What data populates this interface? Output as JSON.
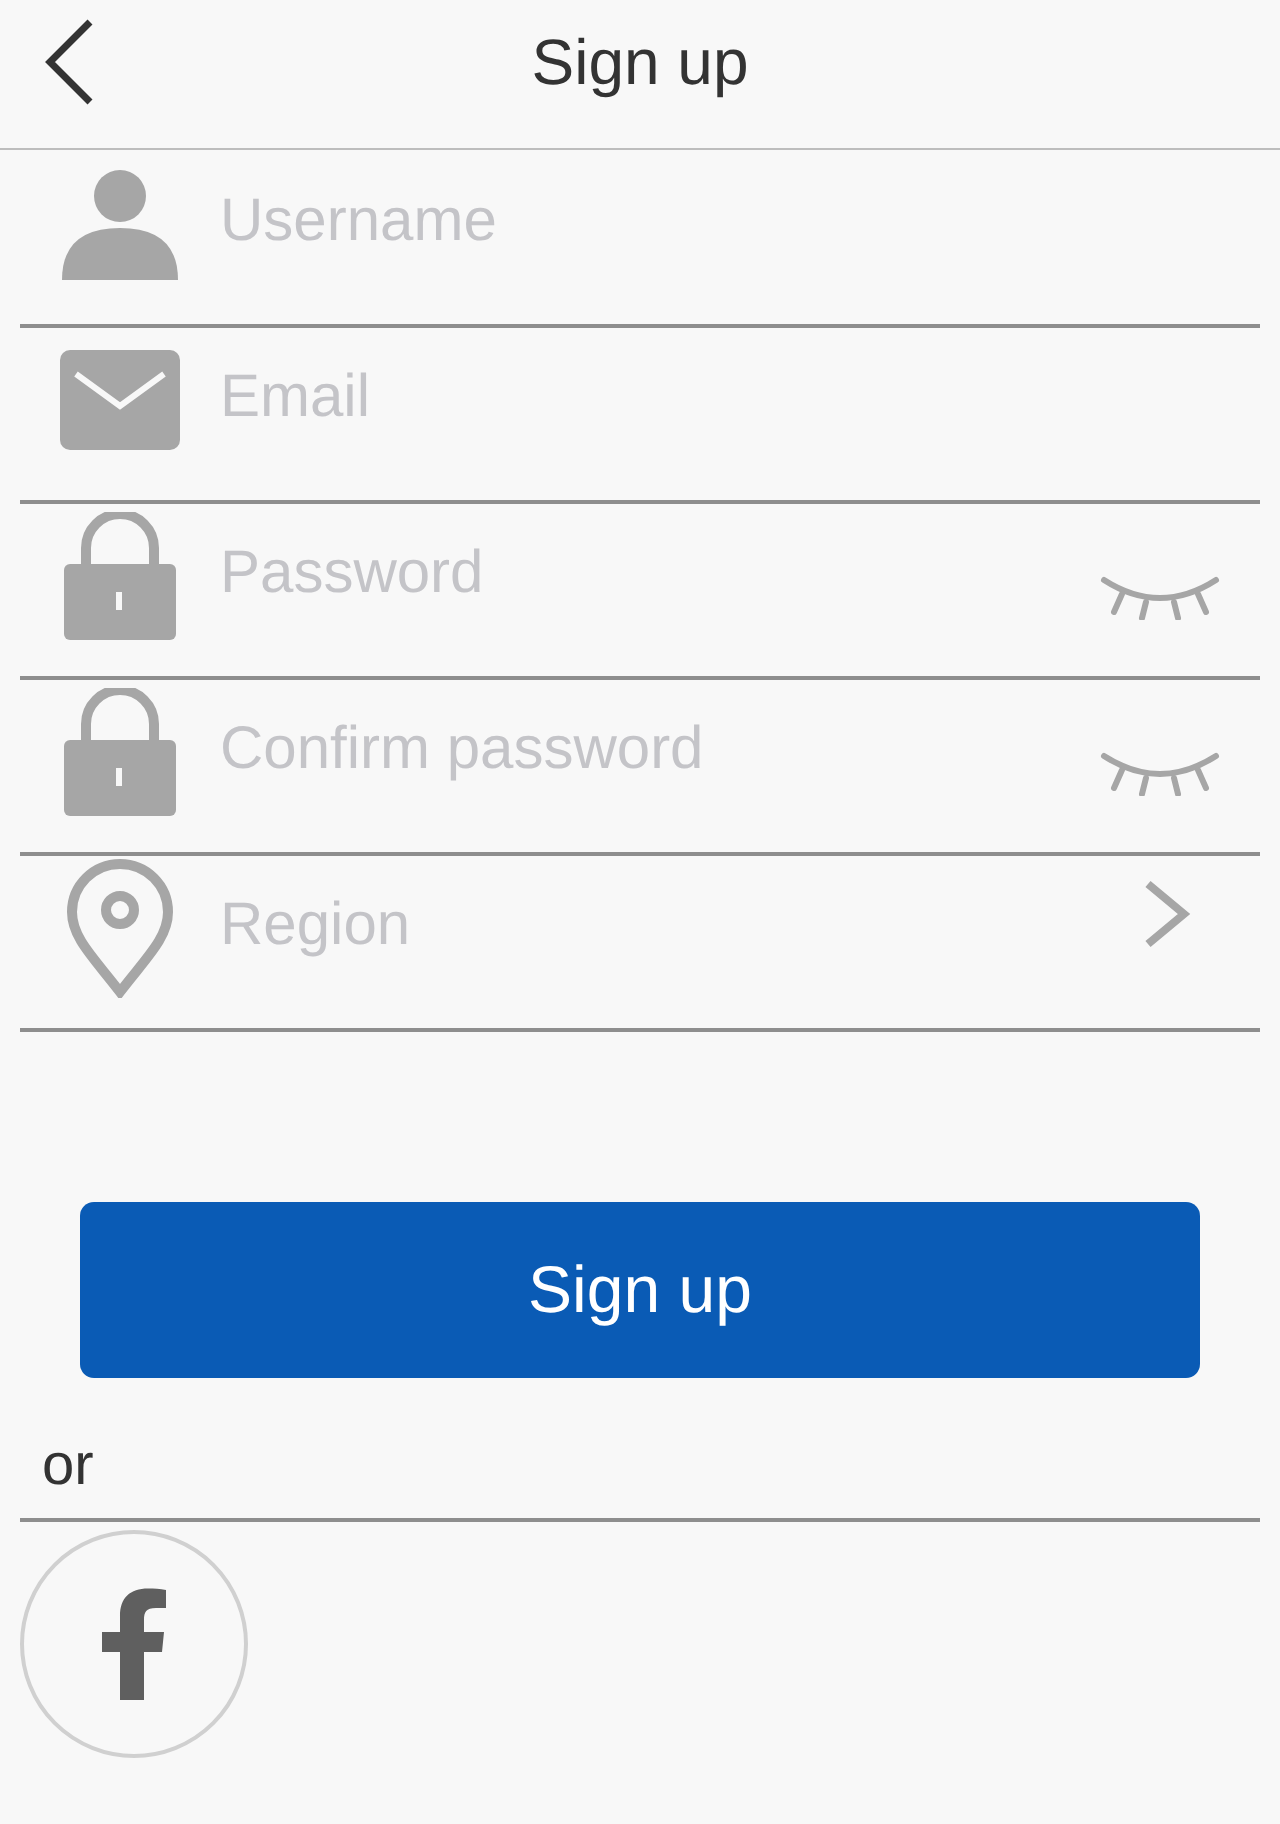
{
  "header": {
    "title": "Sign up"
  },
  "fields": [
    {
      "kind": "username",
      "placeholder": "Username"
    },
    {
      "kind": "email",
      "placeholder": "Email"
    },
    {
      "kind": "password",
      "placeholder": "Password"
    },
    {
      "kind": "password",
      "placeholder": "Confirm password"
    },
    {
      "kind": "select",
      "placeholder": "Region"
    }
  ],
  "submit": {
    "label": "Sign up"
  },
  "divider_text": "or",
  "social": [
    {
      "kind": "facebook"
    }
  ]
}
